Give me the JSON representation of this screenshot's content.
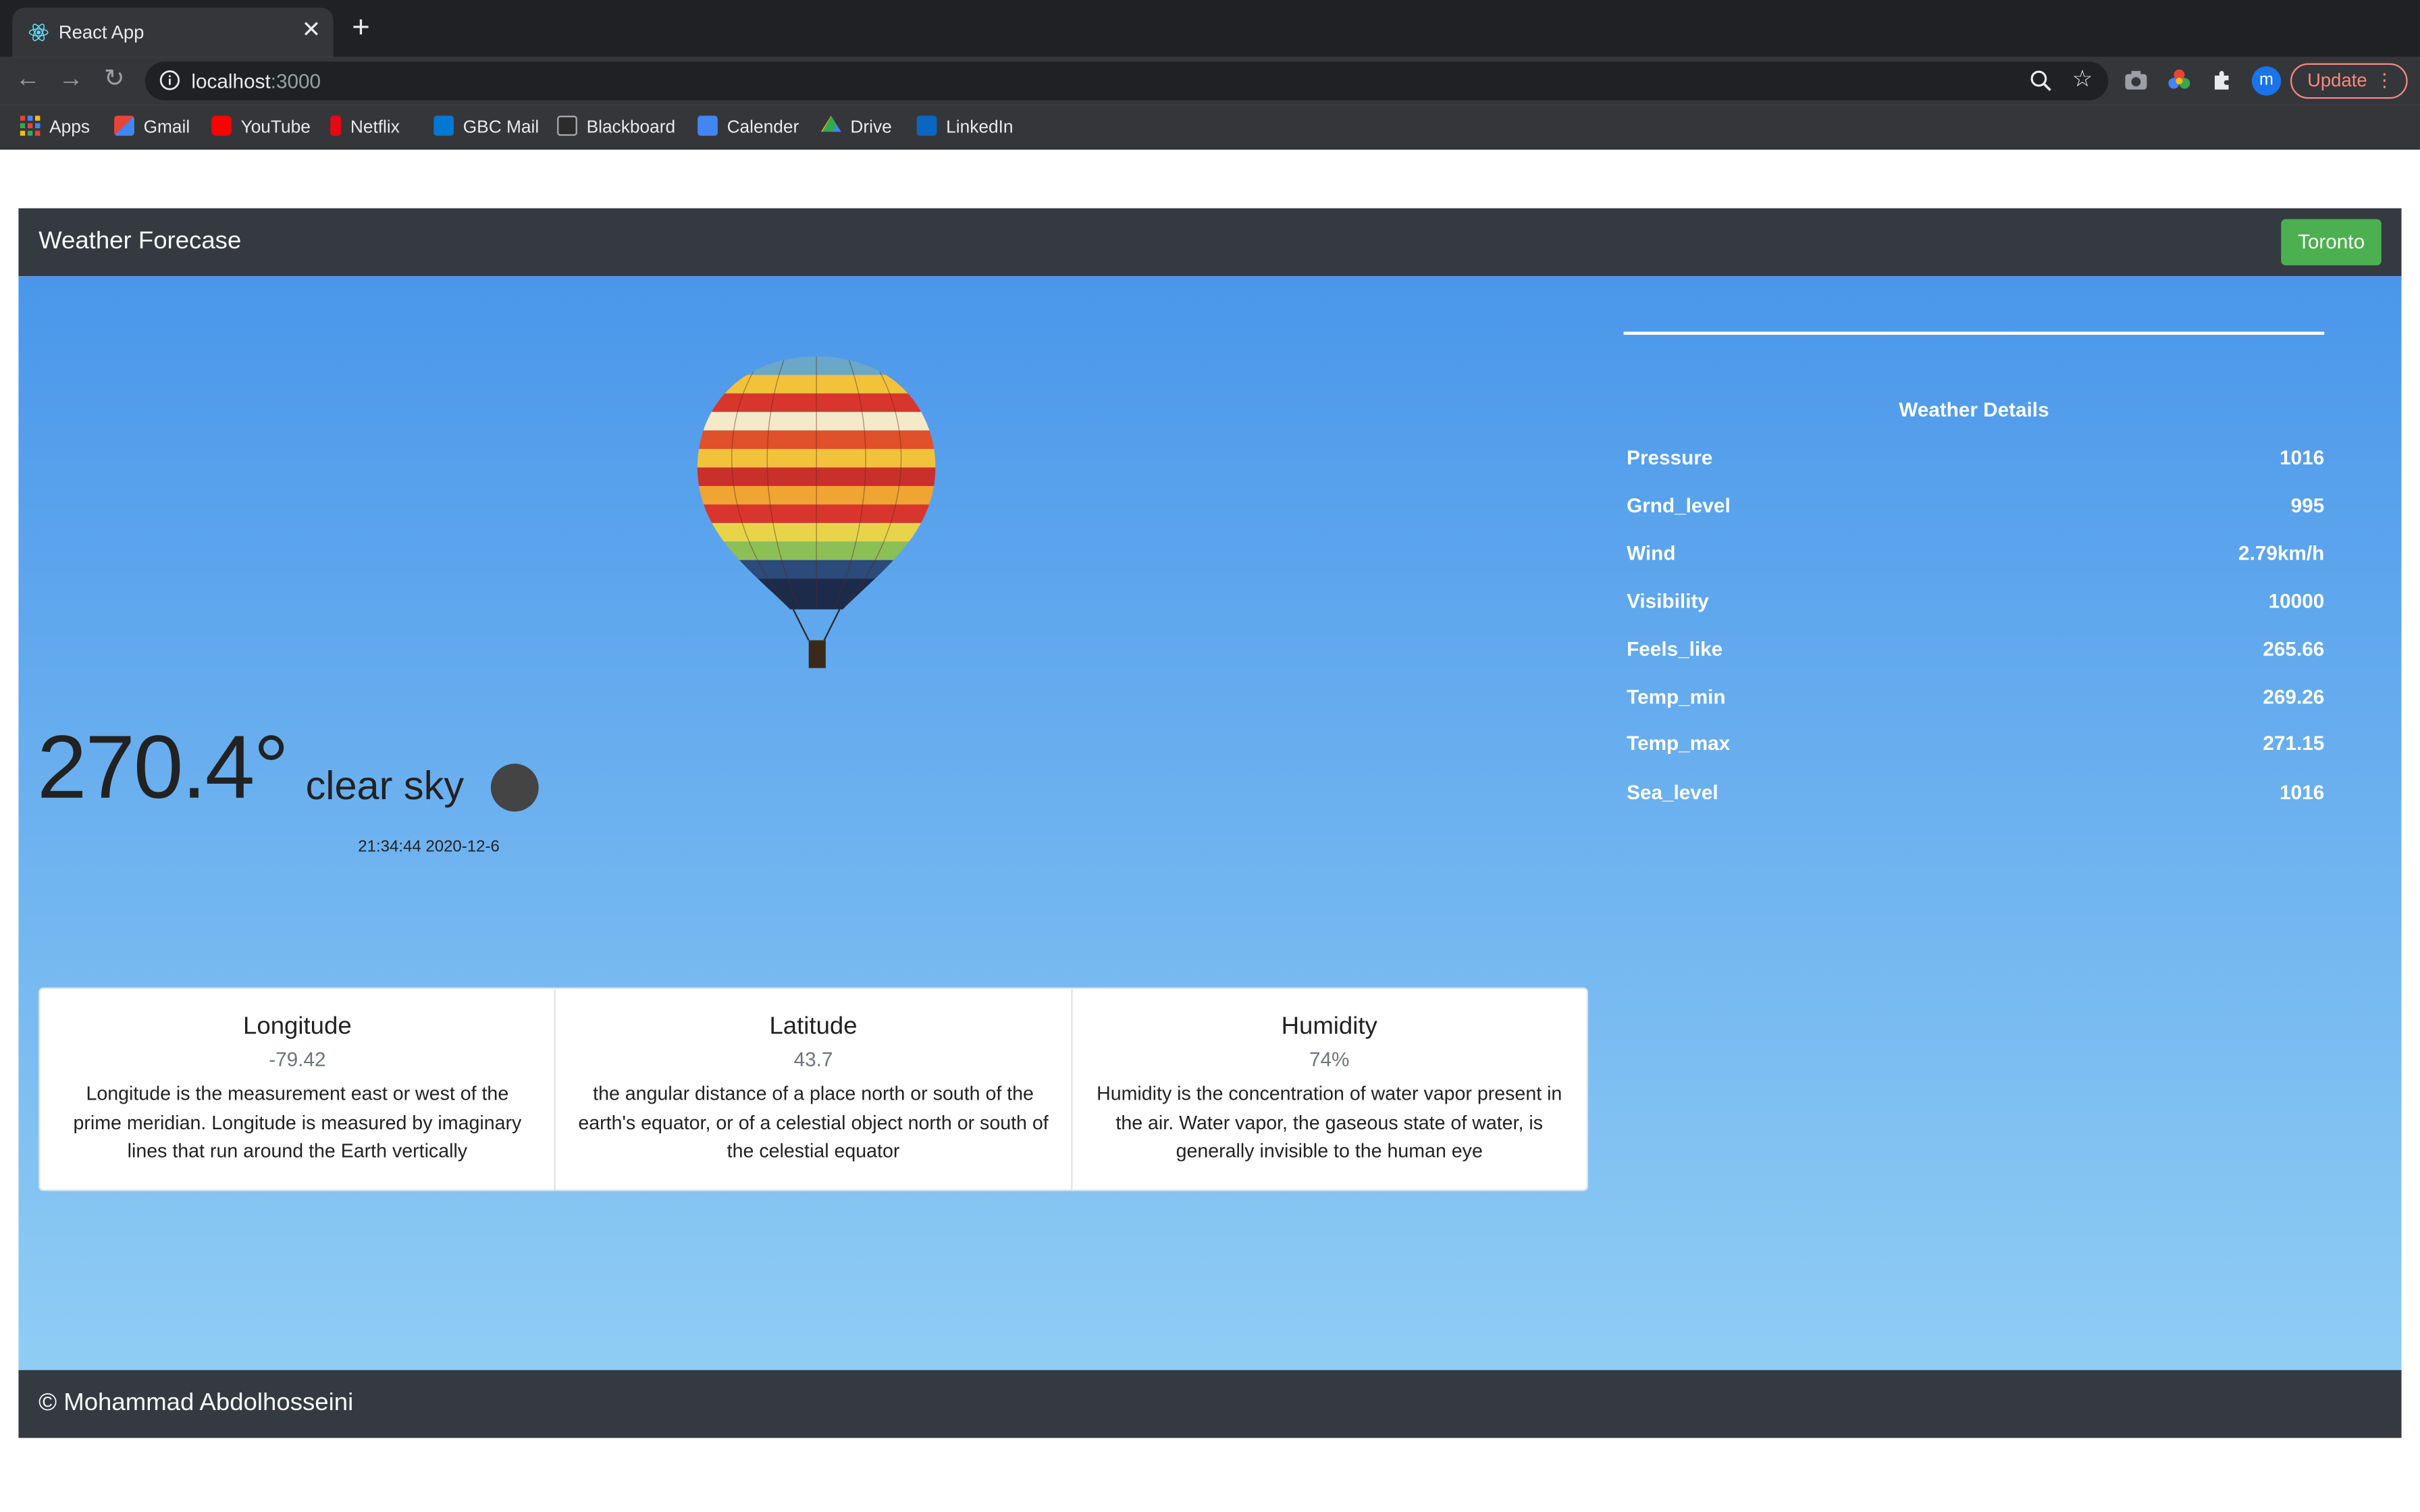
{
  "browser": {
    "tab_title": "React App",
    "url_host": "localhost",
    "url_port": ":3000",
    "update_label": "Update",
    "profile_initial": "m",
    "bookmarks": [
      "Apps",
      "Gmail",
      "YouTube",
      "Netflix",
      "GBC Mail",
      "Blackboard",
      "Calender",
      "Drive",
      "LinkedIn"
    ]
  },
  "app": {
    "brand": "Weather Forecase",
    "city_button": "Toronto",
    "temperature": "270.4°",
    "description": "clear sky",
    "timestamp": "21:34:44 2020-12-6",
    "details_title": "Weather Details",
    "details": [
      {
        "label": "Pressure",
        "value": "1016"
      },
      {
        "label": "Grnd_level",
        "value": "995"
      },
      {
        "label": "Wind",
        "value": "2.79km/h"
      },
      {
        "label": "Visibility",
        "value": "10000"
      },
      {
        "label": "Feels_like",
        "value": "265.66"
      },
      {
        "label": "Temp_min",
        "value": "269.26"
      },
      {
        "label": "Temp_max",
        "value": "271.15"
      },
      {
        "label": "Sea_level",
        "value": "1016"
      }
    ],
    "cards": [
      {
        "title": "Longitude",
        "value": "-79.42",
        "text": "Longitude is the measurement east or west of the prime meridian. Longitude is measured by imaginary lines that run around the Earth vertically"
      },
      {
        "title": "Latitude",
        "value": "43.7",
        "text": "the angular distance of a place north or south of the earth's equator, or of a celestial object north or south of the celestial equator"
      },
      {
        "title": "Humidity",
        "value": "74%",
        "text": "Humidity is the concentration of water vapor present in the air. Water vapor, the gaseous state of water, is generally invisible to the human eye"
      }
    ],
    "footer": "© Mohammad Abdolhosseini"
  },
  "colors": {
    "navbar": "#343a40",
    "city_button": "#4caf50",
    "sky_top": "#4a96ea",
    "sky_bottom": "#90cdf4"
  }
}
